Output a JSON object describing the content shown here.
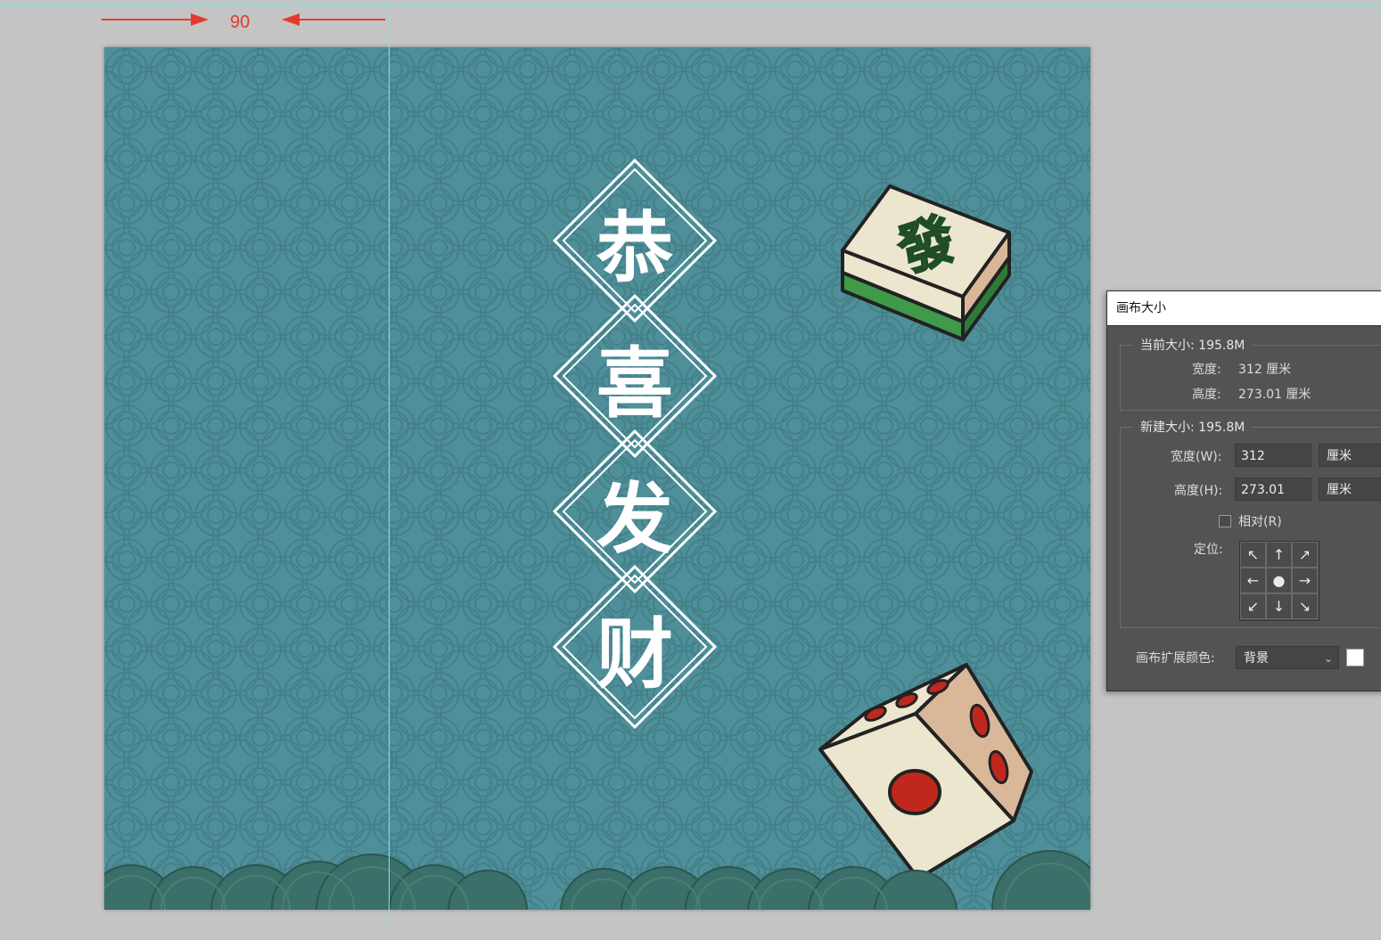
{
  "measure": {
    "value": "90"
  },
  "artwork": {
    "characters": [
      "恭",
      "喜",
      "发",
      "财"
    ],
    "tile_glyph": "發",
    "colors": {
      "background": "#4f8f99",
      "pattern_line": "#43808a",
      "wave_fill": "#3b6f69",
      "tile_face": "#ece6cf",
      "tile_green": "#3f9a4a",
      "dice_pip": "#c0281e"
    }
  },
  "dialog": {
    "title": "画布大小",
    "current": {
      "legend": "当前大小: 195.8M",
      "width_label": "宽度:",
      "width_value": "312 厘米",
      "height_label": "高度:",
      "height_value": "273.01 厘米"
    },
    "new": {
      "legend": "新建大小: 195.8M",
      "width_label": "宽度(W):",
      "width_value": "312",
      "width_unit": "厘米",
      "height_label": "高度(H):",
      "height_value": "273.01",
      "height_unit": "厘米",
      "relative_label": "相对(R)",
      "anchor_label": "定位:",
      "anchor_cells": [
        "↖",
        "↑",
        "↗",
        "←",
        "●",
        "→",
        "↙",
        "↓",
        "↘"
      ]
    },
    "extension_color_label": "画布扩展颜色:",
    "extension_color_value": "背景",
    "swatch_color": "#ffffff"
  }
}
